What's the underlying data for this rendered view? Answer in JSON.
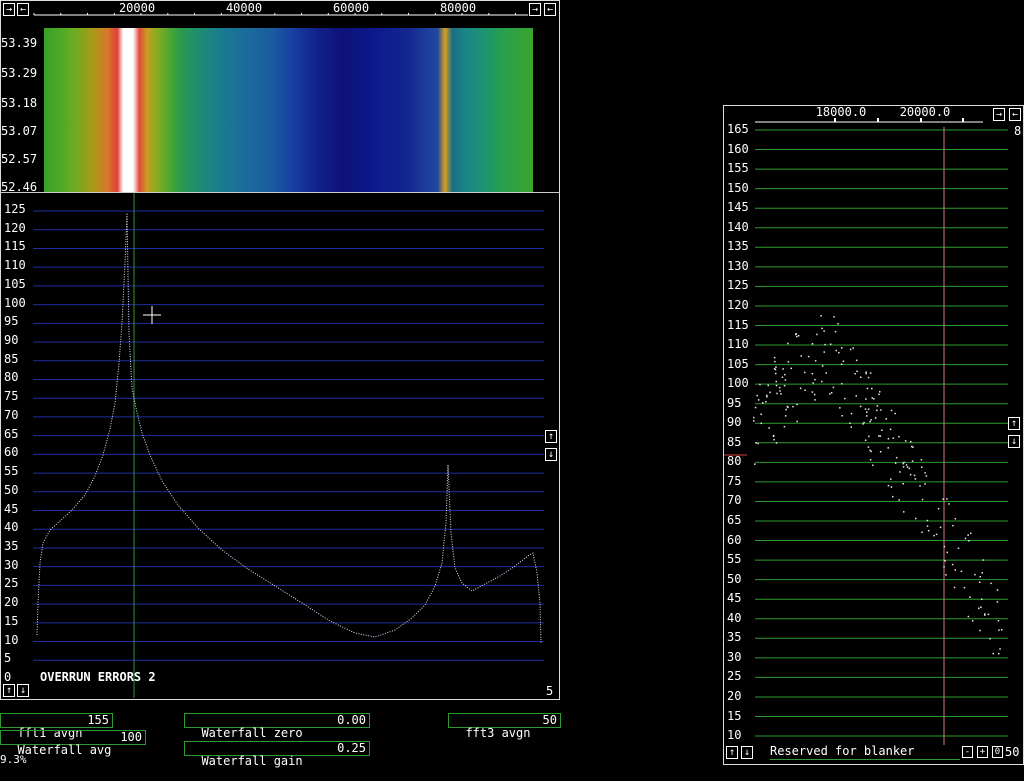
{
  "main_spectrum": {
    "freq_ticks": [
      "20000",
      "40000",
      "60000",
      "80000"
    ],
    "waterfall_time_labels": [
      "53.39",
      "53.29",
      "53.18",
      "53.07",
      "52.57",
      "52.46"
    ],
    "y_ticks": [
      "125",
      "120",
      "115",
      "110",
      "105",
      "100",
      "95",
      "90",
      "85",
      "80",
      "75",
      "70",
      "65",
      "60",
      "55",
      "50",
      "45",
      "40",
      "35",
      "30",
      "25",
      "20",
      "15",
      "10",
      "5",
      "0"
    ],
    "overrun_text": "OVERRUN ERRORS 2",
    "zoom_value": "5"
  },
  "controls": {
    "fft1_avgn_label": "fft1 avgn",
    "fft1_avgn_value": "155",
    "waterfall_avg_label": "Waterfall avg",
    "waterfall_avg_value": "100",
    "waterfall_zero_label": "Waterfall zero",
    "waterfall_zero_value": "0.00",
    "waterfall_gain_label": "Waterfall gain",
    "waterfall_gain_value": "0.25",
    "fft3_avgn_label": "fft3 avgn",
    "fft3_avgn_value": "50",
    "cpu_load": "9.3%"
  },
  "baseband": {
    "freq_ticks": [
      "18000.0",
      "20000.0"
    ],
    "y_ticks": [
      "165",
      "160",
      "155",
      "150",
      "145",
      "140",
      "135",
      "130",
      "125",
      "120",
      "115",
      "110",
      "105",
      "100",
      "95",
      "90",
      "85",
      "80",
      "75",
      "70",
      "65",
      "60",
      "55",
      "50",
      "45",
      "40",
      "35",
      "30",
      "25",
      "20",
      "15",
      "10"
    ],
    "right_value": "8",
    "blanker_label": "Reserved for blanker",
    "blanker_value": "50",
    "minus": "-",
    "plus": "+",
    "zero": "0"
  },
  "icons": {
    "arrow_left": "←",
    "arrow_right": "→",
    "arrow_up": "↑",
    "arrow_down": "↓"
  }
}
